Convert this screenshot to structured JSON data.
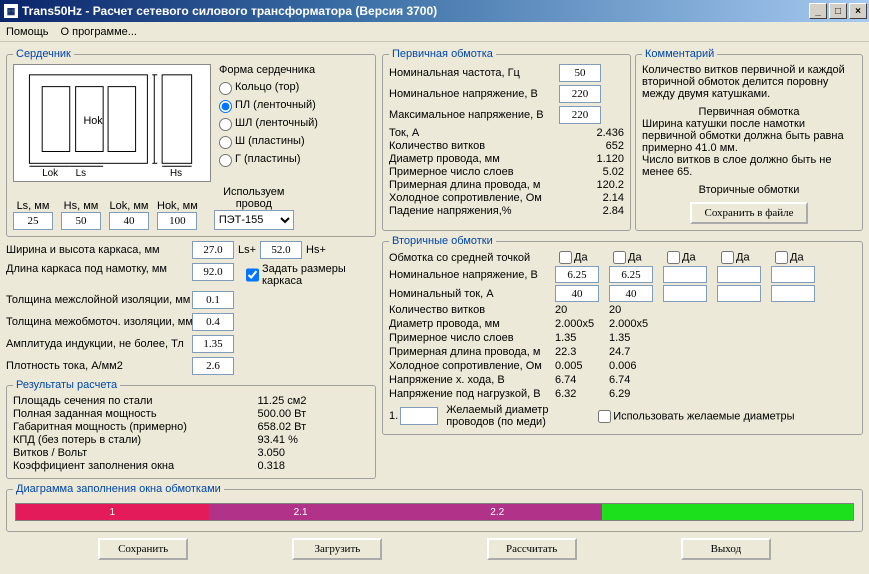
{
  "window": {
    "title": "Trans50Hz - Расчет сетевого силового трансформатора (Версия 3700)",
    "menu_help": "Помощь",
    "menu_about": "О программе..."
  },
  "group_core": "Сердечник",
  "hok_diag": "Hok",
  "lok_diag": "Lok",
  "ls_diag": "Ls",
  "hs_diag": "Hs",
  "core_form": {
    "title": "Форма сердечника",
    "r1": "Кольцо (тор)",
    "r2": "ПЛ (ленточный)",
    "r3": "ШЛ (ленточный)",
    "r4": "Ш (пластины)",
    "r5": "Г (пластины)"
  },
  "dims": {
    "ls_lbl": "Ls, мм",
    "ls": "25",
    "hs_lbl": "Hs, мм",
    "hs": "50",
    "lok_lbl": "Lok, мм",
    "lok": "40",
    "hok_lbl": "Hok, мм",
    "hok": "100",
    "wire_lbl": "Используем провод",
    "wire": "ПЭТ-155"
  },
  "left": {
    "frame_wh": "Ширина и высота каркаса, мм",
    "frame_w": "27.0",
    "ls_plus": "Ls+",
    "frame_h": "52.0",
    "hs_plus": "Hs+",
    "frame_len_lbl": "Длина каркаса под намотку, мм",
    "frame_len": "92.0",
    "frame_check": "Задать размеры каркаса",
    "interlayer_lbl": "Толщина межслойной изоляции, мм",
    "interlayer": "0.1",
    "interwind_lbl": "Толщина межобмоточ. изоляции, мм",
    "interwind": "0.4",
    "induction_lbl": "Амплитуда индукции, не более, Тл",
    "induction": "1.35",
    "density_lbl": "Плотность тока, А/мм2",
    "density": "2.6",
    "results_title": "Результаты расчета",
    "r1l": "Площадь сечения по стали",
    "r1v": "11.25 см2",
    "r2l": "Полная заданная мощность",
    "r2v": "500.00 Вт",
    "r3l": "Габаритная мощность (примерно)",
    "r3v": "658.02 Вт",
    "r4l": "КПД (без потерь в стали)",
    "r4v": "93.41 %",
    "r5l": "Витков / Вольт",
    "r5v": "3.050",
    "r6l": "Коэффициент заполнения окна",
    "r6v": "0.318"
  },
  "primary": {
    "title": "Первичная обмотка",
    "freq_lbl": "Номинальная частота, Гц",
    "freq": "50",
    "nomv_lbl": "Номинальное напряжение, В",
    "nomv": "220",
    "maxv_lbl": "Максимальное напряжение, В",
    "maxv": "220",
    "cur_lbl": "Ток, А",
    "cur": "2.436",
    "turns_lbl": "Количество витков",
    "turns": "652",
    "wdia_lbl": "Диаметр провода, мм",
    "wdia": "1.120",
    "layers_lbl": "Примерное число слоев",
    "layers": "5.02",
    "wlen_lbl": "Примерная длина провода, м",
    "wlen": "120.2",
    "coldr_lbl": "Холодное сопротивление, Ом",
    "coldr": "2.14",
    "vdrop_lbl": "Падение напряжения,%",
    "vdrop": "2.84"
  },
  "comments": {
    "title": "Комментарий",
    "block1": "Количество витков первичной и каждой вторичной обмоток делится поровну между двумя катушками.",
    "sub1": "Первичная обмотка",
    "block2": "Ширина катушки после намотки первичной обмотки должна быть равна примерно 41.0 мм.",
    "block3": "Число витков в слое должно быть не менее 65.",
    "sub2": "Вторичные обмотки",
    "save_btn": "Сохранить в файле"
  },
  "secondary": {
    "title": "Вторичные обмотки",
    "ct_lbl": "Обмотка со средней точкой",
    "da": "Да",
    "nomv_lbl": "Номинальное напряжение, В",
    "nomc_lbl": "Номинальный ток, А",
    "v1": "6.25",
    "v2": "6.25",
    "c1": "40",
    "c2": "40",
    "turns_lbl": "Количество витков",
    "t1": "20",
    "t2": "20",
    "wdia_lbl": "Диаметр провода, мм",
    "d1": "2.000x5",
    "d2": "2.000x5",
    "layers_lbl": "Примерное число слоев",
    "l1": "1.35",
    "l2": "1.35",
    "wlen_lbl": "Примерная длина провода, м",
    "wl1": "22.3",
    "wl2": "24.7",
    "coldr_lbl": "Холодное сопротивление, Ом",
    "cr1": "0.005",
    "cr2": "0.006",
    "vidle_lbl": "Напряжение х. хода, В",
    "vi1": "6.74",
    "vi2": "6.74",
    "vload_lbl": "Напряжение под нагрузкой, В",
    "vl1": "6.32",
    "vl2": "6.29",
    "desired_num": "1.",
    "desired_lbl": "Желаемый диаметр проводов (по меди)",
    "use_desired": "Использовать желаемые диаметры"
  },
  "diagram": {
    "title": "Диаграмма заполнения окна обмотками",
    "seg1": "1",
    "seg2": "2.1",
    "seg3": "2.2"
  },
  "buttons": {
    "save": "Сохранить",
    "load": "Загрузить",
    "calc": "Рассчитать",
    "exit": "Выход"
  }
}
